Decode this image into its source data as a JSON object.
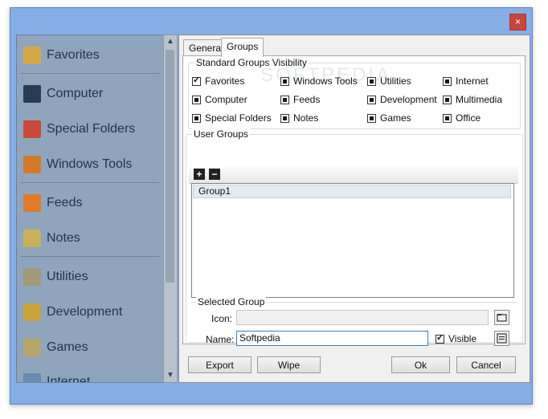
{
  "window": {
    "close_label": "×"
  },
  "sidebar": {
    "items": [
      {
        "label": "Favorites",
        "icon": "star-icon",
        "color": "#d6a84a"
      },
      {
        "label": "Computer",
        "icon": "monitor-icon",
        "color": "#2b3b52"
      },
      {
        "label": "Special Folders",
        "icon": "windows-flag-icon",
        "color": "#c84a3a"
      },
      {
        "label": "Windows Tools",
        "icon": "tools-icon",
        "color": "#d47b2a"
      },
      {
        "label": "Feeds",
        "icon": "rss-icon",
        "color": "#e07b2a"
      },
      {
        "label": "Notes",
        "icon": "notes-icon",
        "color": "#c9b05a"
      },
      {
        "label": "Utilities",
        "icon": "utilities-icon",
        "color": "#a39a7a"
      },
      {
        "label": "Development",
        "icon": "construction-icon",
        "color": "#caa23a"
      },
      {
        "label": "Games",
        "icon": "gamepad-icon",
        "color": "#b5a56a"
      },
      {
        "label": "Internet",
        "icon": "globe-icon",
        "color": "#6a8ab0"
      }
    ]
  },
  "tabs": [
    {
      "label": "General",
      "active": false
    },
    {
      "label": "Groups",
      "active": true
    }
  ],
  "visibility": {
    "legend": "Standard Groups Visibility",
    "items": [
      {
        "label": "Favorites",
        "state": "checked"
      },
      {
        "label": "Windows Tools",
        "state": "indeterminate"
      },
      {
        "label": "Utilities",
        "state": "indeterminate"
      },
      {
        "label": "Internet",
        "state": "indeterminate"
      },
      {
        "label": "Computer",
        "state": "indeterminate"
      },
      {
        "label": "Feeds",
        "state": "indeterminate"
      },
      {
        "label": "Development",
        "state": "indeterminate"
      },
      {
        "label": "Multimedia",
        "state": "indeterminate"
      },
      {
        "label": "Special Folders",
        "state": "indeterminate"
      },
      {
        "label": "Notes",
        "state": "indeterminate"
      },
      {
        "label": "Games",
        "state": "indeterminate"
      },
      {
        "label": "Office",
        "state": "indeterminate"
      }
    ]
  },
  "user_groups": {
    "legend": "User Groups",
    "add_label": "+",
    "remove_label": "−",
    "items": [
      "Group1"
    ]
  },
  "selected_group": {
    "legend": "Selected Group",
    "icon_label": "Icon:",
    "icon_value": "",
    "name_label": "Name:",
    "name_value": "Softpedia",
    "visible_label": "Visible",
    "visible_checked": true
  },
  "buttons": {
    "export": "Export",
    "wipe": "Wipe",
    "ok": "Ok",
    "cancel": "Cancel"
  }
}
